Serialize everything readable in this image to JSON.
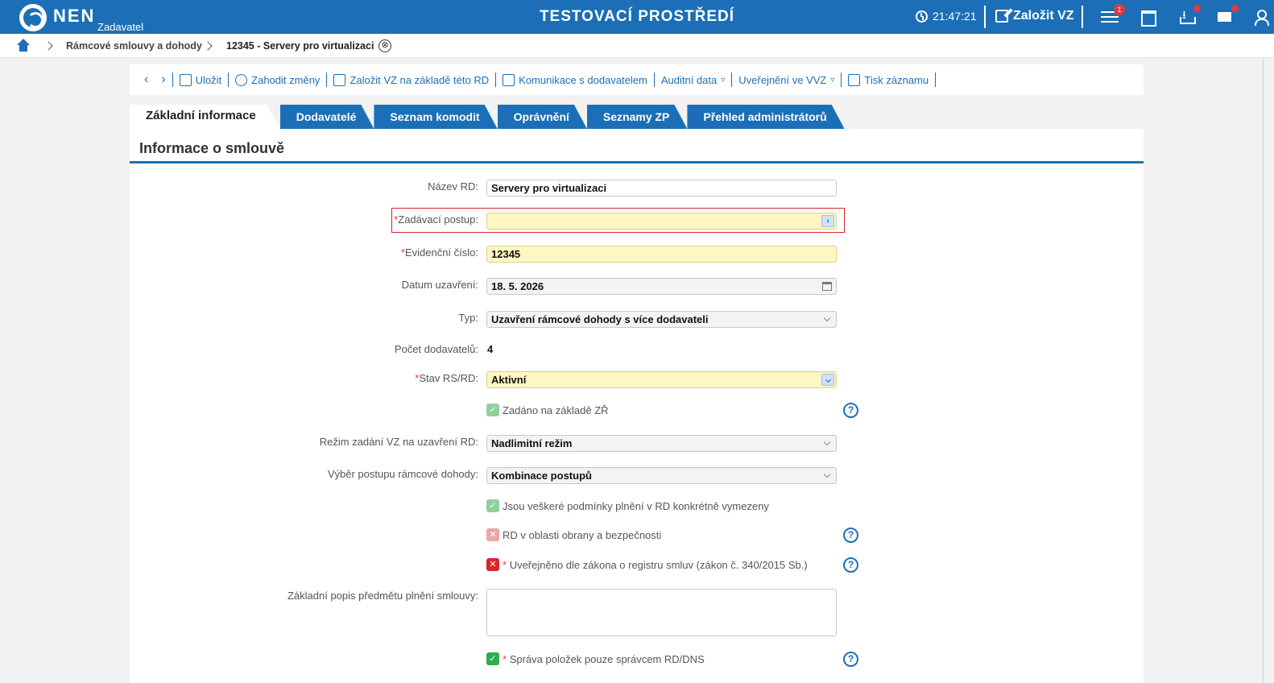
{
  "header": {
    "brand": "NEN",
    "brand_sub": "Zadavatel",
    "env_title": "TESTOVACÍ PROSTŘEDÍ",
    "clock": "21:47:21",
    "create_label": "Založit VZ",
    "menu_badge": "1"
  },
  "breadcrumb": {
    "items": [
      "Rámcové smlouvy a dohody",
      "12345 - Servery pro virtualizaci"
    ],
    "close_icon": "⊗"
  },
  "toolbar": {
    "back": "‹",
    "forward": "›",
    "save": "Uložit",
    "discard": "Zahodit změny",
    "create_vz": "Založit VZ na základě této RD",
    "communication": "Komunikace s dodavatelem",
    "audit": "Auditní data",
    "publish": "Uveřejnění ve VVZ",
    "print": "Tisk záznamu",
    "dropdown_mark": "▿"
  },
  "tabs": [
    "Základní informace",
    "Dodavatelé",
    "Seznam komodit",
    "Oprávnění",
    "Seznamy ZP",
    "Přehled administrátorů"
  ],
  "section": {
    "title": "Informace o smlouvě"
  },
  "form": {
    "nazev_label": "Název RD:",
    "nazev_value": "Servery pro virtualizaci",
    "postup_label": "Zadávací postup:",
    "postup_value": "",
    "evid_label": "Evidenční číslo:",
    "evid_value": "12345",
    "datum_label": "Datum uzavření:",
    "datum_value": "18. 5. 2026",
    "typ_label": "Typ:",
    "typ_value": "Uzavření rámcové dohody s více dodavateli",
    "pocet_label": "Počet dodavatelů:",
    "pocet_value": "4",
    "stav_label": "Stav RS/RD:",
    "stav_value": "Aktivní",
    "zadano_label": "Zadáno na základě ZŘ",
    "rezim_label": "Režim zadání VZ na uzavření RD:",
    "rezim_value": "Nadlimitní režim",
    "vyber_label": "Výběr postupu rámcové dohody:",
    "vyber_value": "Kombinace postupů",
    "podminky_label": "Jsou veškeré podmínky plnění v RD konkrétně vymezeny",
    "obrana_label": "RD v oblasti obrany a bezpečnosti",
    "registr_label": "Uveřejněno dle zákona o registru smluv (zákon č. 340/2015 Sb.)",
    "popis_label": "Základní popis předmětu plnění smlouvy:",
    "sprava_label": "Správa položek pouze správcem RD/DNS",
    "required_mark": "*",
    "check_mark": "✓",
    "cross_mark": "✕",
    "help_mark": "?",
    "lookup_mark": "›"
  },
  "colors": {
    "primary": "#1c6fb6",
    "required_field": "#fff7c2",
    "error": "#d9252c",
    "success": "#2fae4a"
  }
}
